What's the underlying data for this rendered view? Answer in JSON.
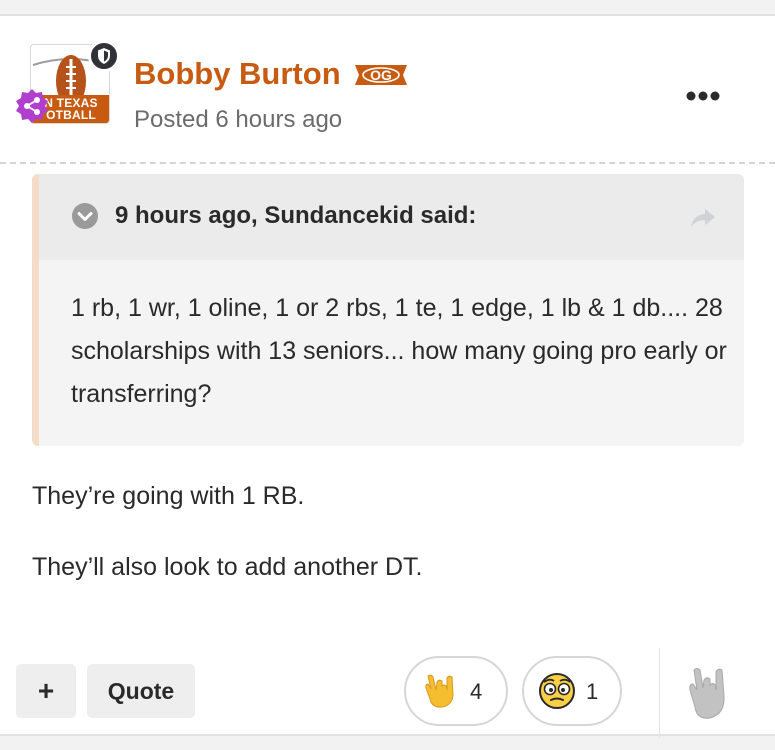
{
  "post": {
    "author": "Bobby Burton",
    "author_badge": "OG",
    "posted": "Posted 6 hours ago",
    "avatar": {
      "line1": "N TEXAS",
      "line2": "OTBALL"
    },
    "quote": {
      "citation": "9 hours ago, Sundancekid said:",
      "text": "1 rb, 1 wr, 1 oline, 1 or 2 rbs, 1 te, 1 edge, 1 lb & 1 db.... 28 scholarships with 13 seniors... how many going pro early or transferring?"
    },
    "body": [
      "They’re going with 1 RB.",
      "They’ll also look to add another DT."
    ]
  },
  "footer": {
    "plus_label": "+",
    "quote_label": "Quote",
    "reactions": [
      {
        "icon": "horns-hand-emoji",
        "count": "4"
      },
      {
        "icon": "flushed-monocle-emoji",
        "count": "1"
      }
    ],
    "react_icon": "horns-hand-gray-icon"
  },
  "colors": {
    "author": "#c75b12",
    "quote_border": "#f3dcc8",
    "quote_header_bg": "#ebebeb",
    "quote_bg": "#f4f4f4",
    "badge_dark": "#2f3338",
    "share_badge": "#b03fd0"
  }
}
